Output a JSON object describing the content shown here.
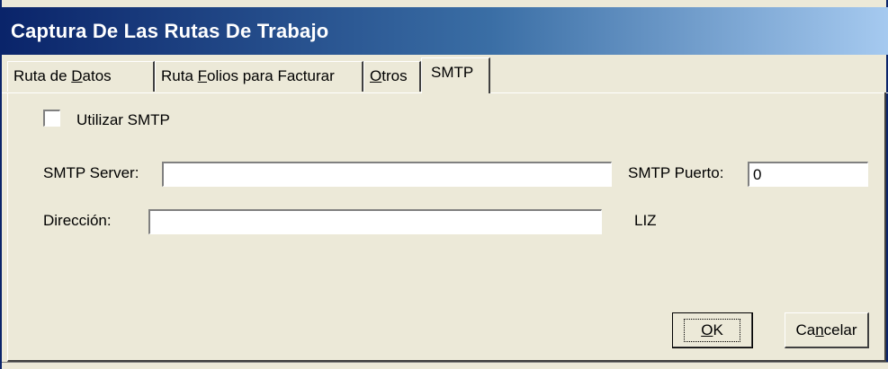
{
  "window": {
    "title": "Captura De Las Rutas De Trabajo"
  },
  "tabs": [
    {
      "label": "Ruta de Datos",
      "pre": "Ruta de ",
      "accel": "D",
      "post": "atos",
      "active": false
    },
    {
      "label": "Ruta Folios para Facturar",
      "pre": "Ruta ",
      "accel": "F",
      "post": "olios para Facturar",
      "active": false
    },
    {
      "label": "Otros",
      "pre": "",
      "accel": "O",
      "post": "tros",
      "active": false
    },
    {
      "label": "SMTP",
      "pre": "SMTP",
      "accel": "",
      "post": "",
      "active": true
    }
  ],
  "form": {
    "use_smtp_label": "Utilizar SMTP",
    "use_smtp_checked": false,
    "server_label": "SMTP Server:",
    "server_value": "",
    "port_label": "SMTP Puerto:",
    "port_value": "0",
    "address_label": "Dirección:",
    "address_value": "",
    "user_text": "LIZ"
  },
  "buttons": {
    "ok": {
      "label": "OK",
      "accel": "O",
      "rest": "K"
    },
    "cancel": {
      "label": "Cancelar",
      "pre": "Ca",
      "accel": "n",
      "post": "celar"
    }
  },
  "colors": {
    "face": "#ece9d8",
    "title_start": "#0a246a",
    "title_end": "#a6caf0"
  }
}
